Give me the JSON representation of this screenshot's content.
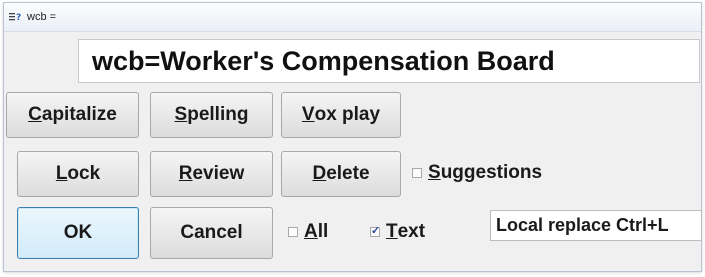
{
  "window": {
    "title": "wcb ="
  },
  "entry": {
    "text": "wcb=Worker's Compensation Board"
  },
  "buttons": {
    "capitalize": {
      "first": "C",
      "rest": "apitalize"
    },
    "spelling": {
      "first": "S",
      "rest": "pelling"
    },
    "vox_play": {
      "first": "V",
      "rest": "ox play"
    },
    "lock": {
      "first": "L",
      "rest": "ock"
    },
    "review": {
      "first": "R",
      "rest": "eview"
    },
    "delete": {
      "first": "D",
      "rest": "elete"
    },
    "ok": {
      "label": "OK"
    },
    "cancel": {
      "label": "Cancel"
    }
  },
  "checkboxes": {
    "suggestions": {
      "first": "",
      "underlined": "S",
      "rest": "uggestions",
      "checked": false
    },
    "all": {
      "underlined": "A",
      "rest": "ll",
      "checked": false
    },
    "text": {
      "underlined": "T",
      "rest": "ext",
      "checked": true
    }
  },
  "replace_combo": {
    "value": "Local replace Ctrl+L"
  },
  "icons": {
    "app": "text-replace-icon"
  }
}
